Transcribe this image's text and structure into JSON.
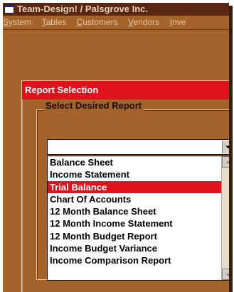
{
  "app": {
    "title": "Team-Design! / Palsgrove Inc."
  },
  "menu": {
    "items": [
      {
        "prefix": "",
        "underline": "S",
        "rest": "ystem"
      },
      {
        "prefix": "",
        "underline": "T",
        "rest": "ables"
      },
      {
        "prefix": "",
        "underline": "C",
        "rest": "ustomers"
      },
      {
        "prefix": "",
        "underline": "V",
        "rest": "endors"
      },
      {
        "prefix": "",
        "underline": "I",
        "rest": "nve"
      }
    ]
  },
  "dialog": {
    "title": "Report Selection",
    "group_label": "Select Desired Report",
    "combo_value": "",
    "options": [
      "Balance Sheet",
      "Income Statement",
      "Trial Balance",
      "Chart Of Accounts",
      "12 Month Balance Sheet",
      "12 Month Income Statement",
      "12 Month Budget Report",
      "Income Budget Variance",
      "Income Comparison Report"
    ],
    "selected_index": 2
  },
  "colors": {
    "titlebar_bg": "#5a2712",
    "app_bg": "#a4632b",
    "header_red": "#e0131c",
    "selection_red": "#e0131c"
  },
  "icons": [
    "app-icon",
    "dropdown-arrow-icon",
    "scroll-up-icon",
    "scroll-down-icon"
  ]
}
